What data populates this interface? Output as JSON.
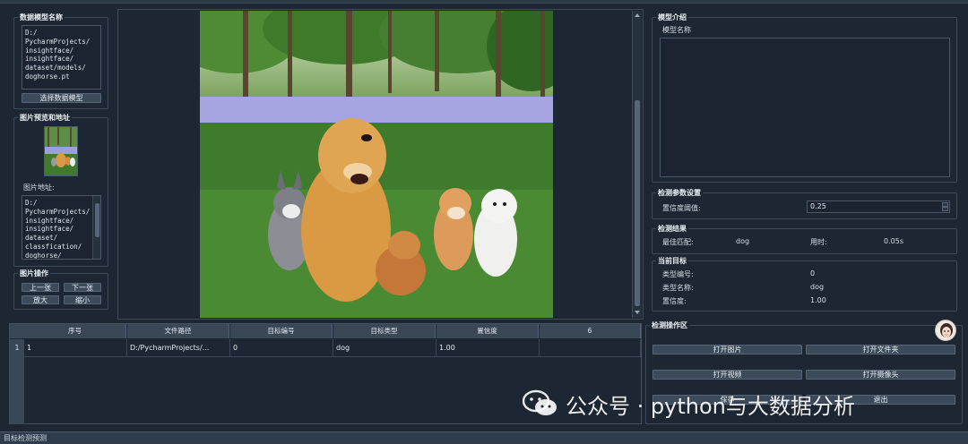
{
  "left": {
    "model_group": {
      "title": "数据模型名称",
      "path": "D:/\nPycharmProjects/\ninsightface/\ninsightface/\ndataset/models/\ndoghorse.pt",
      "select_button": "选择数据模型"
    },
    "preview_group": {
      "title": "图片预览和地址",
      "address_label": "图片地址:",
      "path": "D:/\nPycharmProjects/\ninsightface/\ninsightface/\ndataset/\nclassfication/\ndoghorse/"
    },
    "ops_group": {
      "title": "图片操作",
      "prev": "上一张",
      "next": "下一张",
      "zoom_in": "放大",
      "zoom_out": "缩小"
    }
  },
  "right": {
    "intro_group": {
      "title": "模型介绍",
      "model_name_label": "模型名称"
    },
    "params_group": {
      "title": "检测参数设置",
      "conf_label": "置信度阈值:",
      "conf_value": "0.25"
    },
    "result_group": {
      "title": "检测结果",
      "best_label": "最佳匹配:",
      "best_value": "dog",
      "time_label": "用时:",
      "time_value": "0.05s"
    },
    "target_group": {
      "title": "当前目标",
      "type_id_label": "类型编号:",
      "type_id_value": "0",
      "type_name_label": "类型名称:",
      "type_name_value": "dog",
      "conf_label": "置信度:",
      "conf_value": "1.00"
    },
    "ops_group": {
      "title": "检测操作区",
      "open_image": "打开图片",
      "open_folder": "打开文件夹",
      "open_video": "打开视频",
      "open_camera": "打开摄像头",
      "save": "保存",
      "exit": "退出"
    }
  },
  "table": {
    "columns": [
      "序号",
      "文件路径",
      "目标编号",
      "目标类型",
      "置信度",
      "6"
    ],
    "rows": [
      {
        "index": "1",
        "cells": [
          "1",
          "D:/PycharmProjects/...",
          "0",
          "dog",
          "1.00",
          ""
        ]
      }
    ]
  },
  "status": "目标检测预测",
  "watermark": "公众号 · python与大数据分析",
  "colors": {
    "background": "#1d2733",
    "border": "#3e4b5a",
    "button": "#3d4a5a",
    "grass": "#3f7a2e",
    "flowers": "#a9a6e6"
  }
}
